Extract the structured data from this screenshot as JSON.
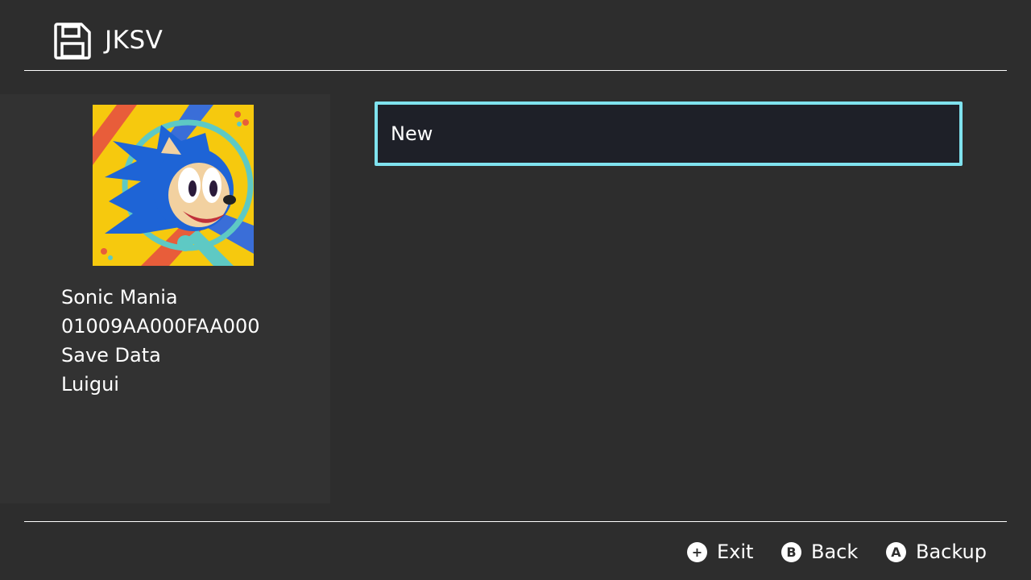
{
  "app": {
    "title": "JKSV",
    "icon": "floppy-disk-icon"
  },
  "title_info": {
    "cover_art": "sonic-mania-cover-art",
    "game_name": "Sonic Mania",
    "title_id": "01009AA000FAA000",
    "save_type": "Save Data",
    "user": "Luigui"
  },
  "save_list": {
    "items": [
      {
        "label": "New"
      }
    ],
    "selected_index": 0
  },
  "footer": {
    "hints": [
      {
        "glyph": "+",
        "label": "Exit",
        "icon": "plus-button-icon"
      },
      {
        "glyph": "B",
        "label": "Back",
        "icon": "b-button-icon"
      },
      {
        "glyph": "A",
        "label": "Backup",
        "icon": "a-button-icon"
      }
    ]
  },
  "colors": {
    "background": "#2d2d2d",
    "panel": "#323232",
    "selection_border": "#7fe2ee",
    "selection_fill": "#1e2028",
    "text": "#ffffff"
  }
}
